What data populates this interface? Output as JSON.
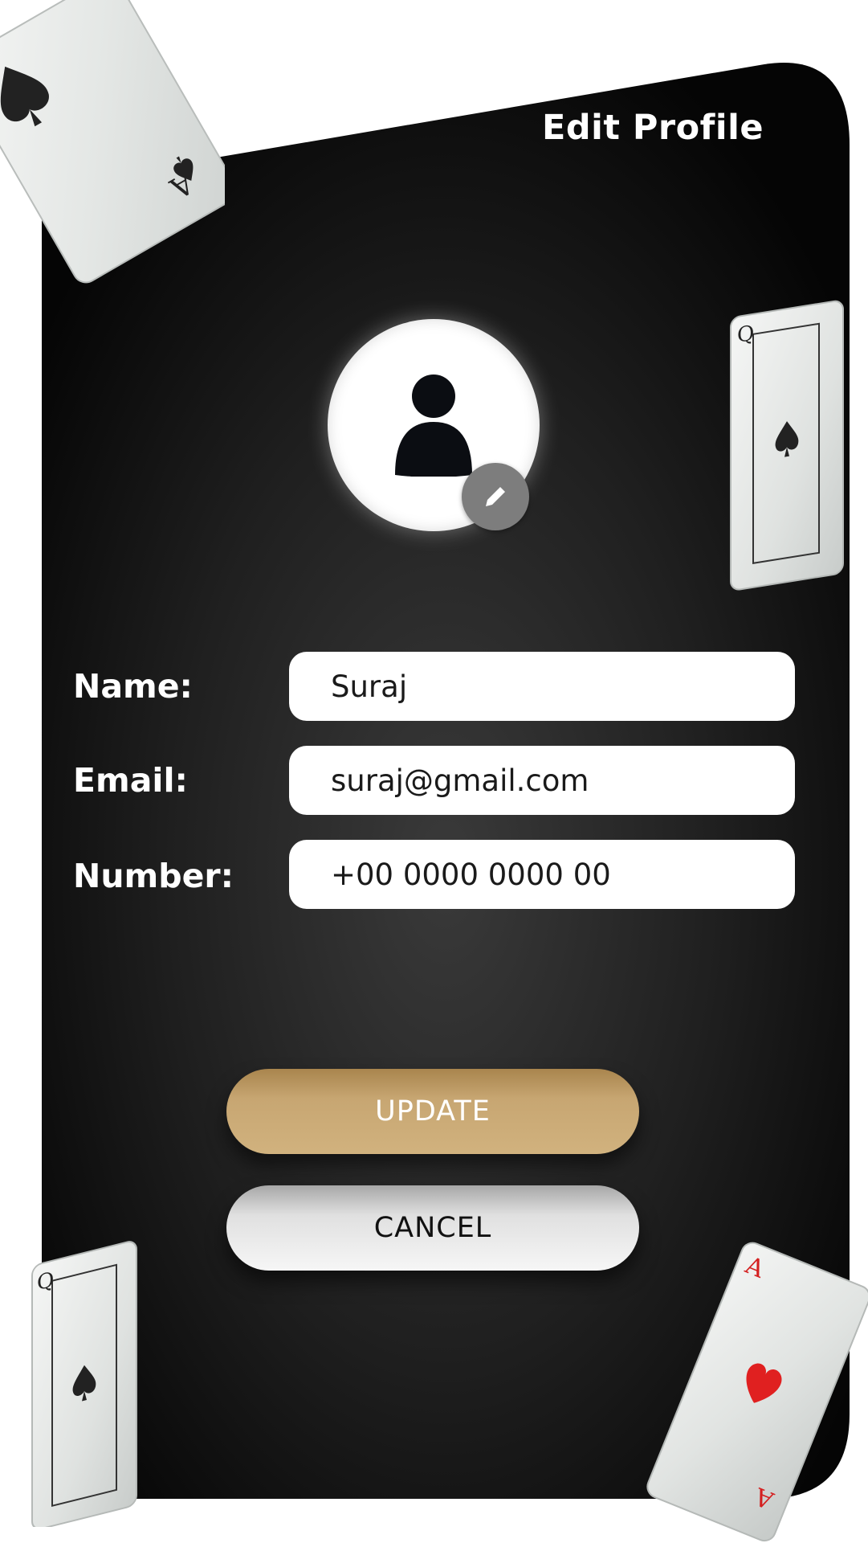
{
  "header": {
    "title": "Edit Profile"
  },
  "avatar": {
    "icon": "user-icon",
    "edit_icon": "pencil-icon"
  },
  "form": {
    "name_label": "Name:",
    "name_value": "Suraj",
    "email_label": "Email:",
    "email_value": "suraj@gmail.com",
    "number_label": "Number:",
    "number_value": "+00 0000 0000 00"
  },
  "buttons": {
    "update_label": "UPDATE",
    "cancel_label": "CANCEL"
  },
  "cards": {
    "top_left": {
      "rank": "A",
      "suit": "spade"
    },
    "right": {
      "rank": "Q",
      "suit": "spade"
    },
    "bottom_left": {
      "rank": "Q",
      "suit": "spade"
    },
    "bottom_right": {
      "rank": "A",
      "suit": "heart"
    }
  },
  "colors": {
    "panel_top": "#000000",
    "panel_mid": "#3a3a3a",
    "accent_gold": "#c7a672",
    "heart_red": "#e02020"
  }
}
